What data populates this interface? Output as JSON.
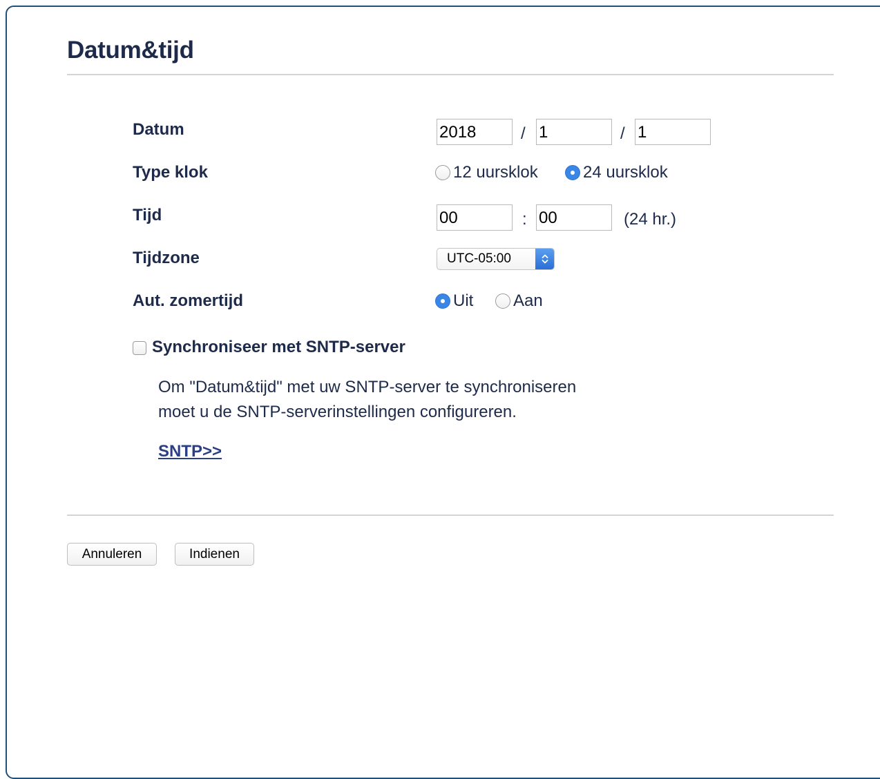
{
  "header": {
    "title": "Datum&tijd"
  },
  "form": {
    "date": {
      "label": "Datum",
      "year": "2018",
      "separator": "/",
      "month": "1",
      "day": "1"
    },
    "clock_type": {
      "label": "Type klok",
      "options": [
        "12 uursklok",
        "24 uursklok"
      ],
      "selected": "24 uursklok"
    },
    "time": {
      "label": "Tijd",
      "hour": "00",
      "separator": ":",
      "minute": "00",
      "unit": "(24 hr.)"
    },
    "timezone": {
      "label": "Tijdzone",
      "selected": "UTC-05:00"
    },
    "dst": {
      "label": "Aut. zomertijd",
      "options": [
        "Uit",
        "Aan"
      ],
      "selected": "Uit"
    },
    "sntp": {
      "checkbox_label": "Synchroniseer met SNTP-server",
      "checked": false,
      "info_line_1": "Om \"Datum&tijd\" met uw SNTP-server te synchroniseren",
      "info_line_2": "moet u de SNTP-serverinstellingen configureren.",
      "link": "SNTP>>"
    }
  },
  "buttons": {
    "cancel": "Annuleren",
    "submit": "Indienen"
  },
  "colors": {
    "text": "#1d2a4a",
    "accent": "#3a86e6",
    "link": "#2b3f86",
    "frame_border": "#1f4f7a"
  },
  "icons": {
    "select_arrows": "chevron-up-down-icon"
  }
}
